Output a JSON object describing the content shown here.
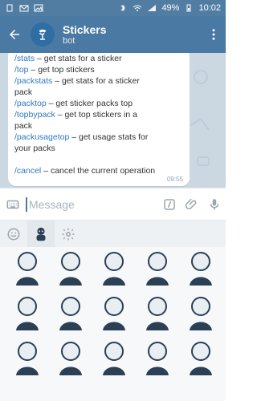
{
  "status_bar": {
    "battery_percent": "49%",
    "time": "10:02",
    "icons": [
      "sim-icon",
      "mail-icon",
      "image-icon",
      "bluetooth-icon",
      "wifi-icon",
      "signal-icon",
      "battery-icon"
    ]
  },
  "header": {
    "title": "Stickers",
    "subtitle": "bot"
  },
  "message": {
    "time": "09:55",
    "lines": [
      {
        "cmd": "/stats",
        "text": " – get stats for a sticker"
      },
      {
        "cmd": "/top",
        "text": " – get top stickers"
      },
      {
        "cmd": "/packstats",
        "text": " – get stats for a sticker"
      },
      {
        "cmd": "",
        "text": "pack"
      },
      {
        "cmd": "/packtop",
        "text": " – get sticker packs top"
      },
      {
        "cmd": "/topbypack",
        "text": " – get top stickers in a"
      },
      {
        "cmd": "",
        "text": "pack"
      },
      {
        "cmd": "/packusagetop",
        "text": " – get usage stats for"
      },
      {
        "cmd": "",
        "text": "your packs"
      },
      {
        "cmd": "",
        "text": ""
      },
      {
        "cmd": "/cancel",
        "text": " – cancel the current operation"
      }
    ]
  },
  "input": {
    "placeholder": "Message"
  },
  "sticker_panel": {
    "active_tab": 1,
    "tabs": [
      {
        "name": "smile-icon"
      },
      {
        "name": "sticker-pack-tab"
      },
      {
        "name": "gear-icon"
      }
    ]
  },
  "colors": {
    "header_bg": "#4a79a4",
    "status_bg": "#527da3",
    "chat_bg": "#cbd8e2",
    "command_blue": "#2f79c2"
  }
}
